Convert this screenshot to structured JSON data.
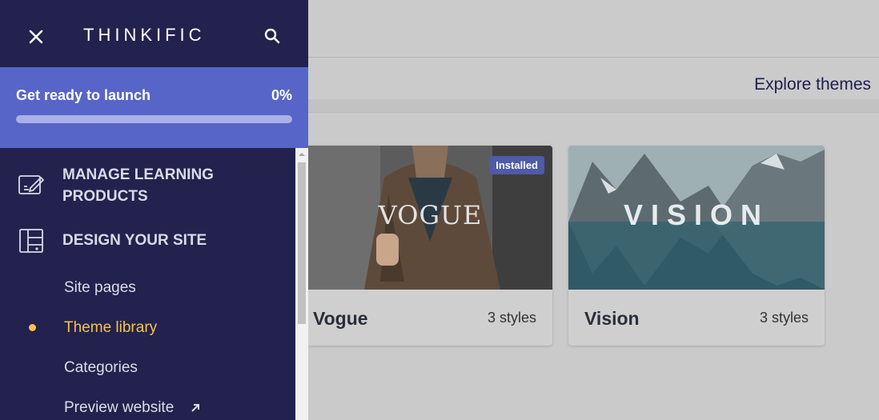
{
  "sidebar": {
    "logo": "THINKIFIC",
    "launch": {
      "title": "Get ready to launch",
      "percent_label": "0%",
      "progress": 0
    },
    "sections": [
      {
        "label": "MANAGE LEARNING PRODUCTS",
        "icon": "edit-document-icon"
      },
      {
        "label": "DESIGN YOUR SITE",
        "icon": "layout-icon"
      }
    ],
    "design_items": [
      {
        "label": "Site pages"
      },
      {
        "label": "Theme library",
        "active": true
      },
      {
        "label": "Categories"
      },
      {
        "label": "Preview website",
        "icon": "external-link-icon"
      }
    ]
  },
  "main": {
    "explore_label": "Explore themes",
    "themes": [
      {
        "name": "Vogue",
        "styles": "3 styles",
        "badge": "Installed",
        "thumb_title": "VOGUE"
      },
      {
        "name": "Vision",
        "styles": "3 styles",
        "thumb_title": "VISION"
      }
    ]
  },
  "colors": {
    "sidebar_bg": "#23224e",
    "launch_bg": "#5765c8",
    "active_item": "#f3c34d",
    "badge_bg": "#4f5aa8"
  }
}
